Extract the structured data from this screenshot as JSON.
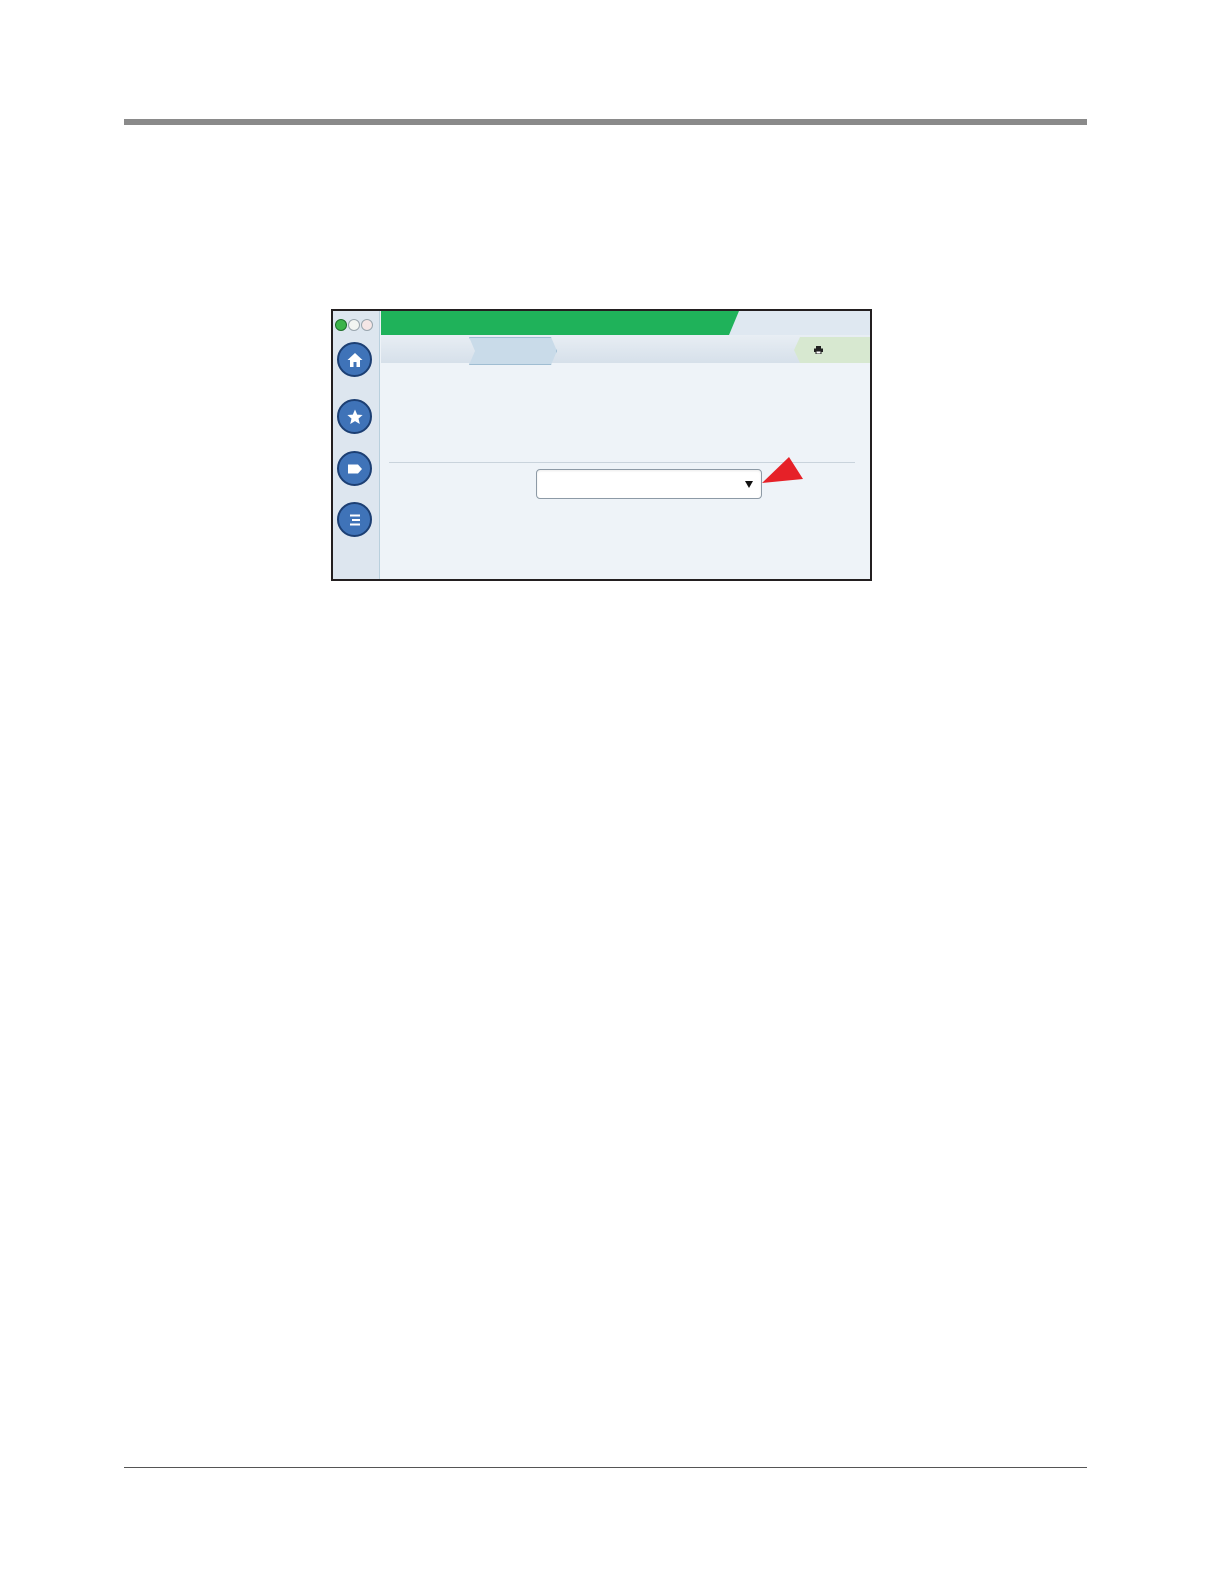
{
  "document": {},
  "screen": {
    "status_lights": [
      "status-green",
      "status-white",
      "status-pink"
    ],
    "nav": [
      "home-icon",
      "star-icon",
      "tag-icon",
      "menu-icon"
    ],
    "header": {
      "accent_color": "#1fb25a"
    },
    "breadcrumb": {
      "active_tab": ""
    },
    "toolbar": {
      "print_icon": "printer-icon"
    },
    "form": {
      "select_value": ""
    },
    "callout": {
      "color": "#e62128"
    }
  }
}
